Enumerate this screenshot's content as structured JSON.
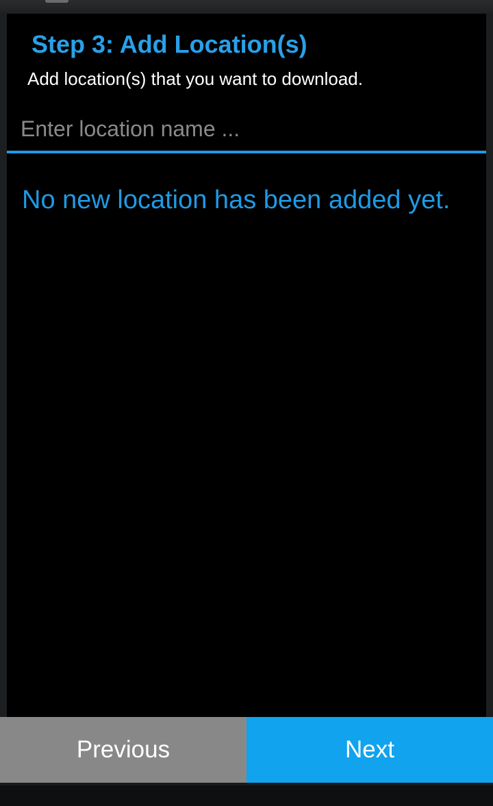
{
  "step": {
    "title": "Step 3: Add Location(s)",
    "subtitle": "Add location(s) that you want to download."
  },
  "search": {
    "value": "",
    "placeholder": "Enter location name ..."
  },
  "locations": {
    "items": [],
    "empty_message": "No new location has been added yet."
  },
  "footer": {
    "previous_label": "Previous",
    "next_label": "Next"
  },
  "colors": {
    "accent": "#1f9ae5",
    "next_button": "#11a3ed",
    "previous_button": "#888888",
    "background": "#000000"
  }
}
